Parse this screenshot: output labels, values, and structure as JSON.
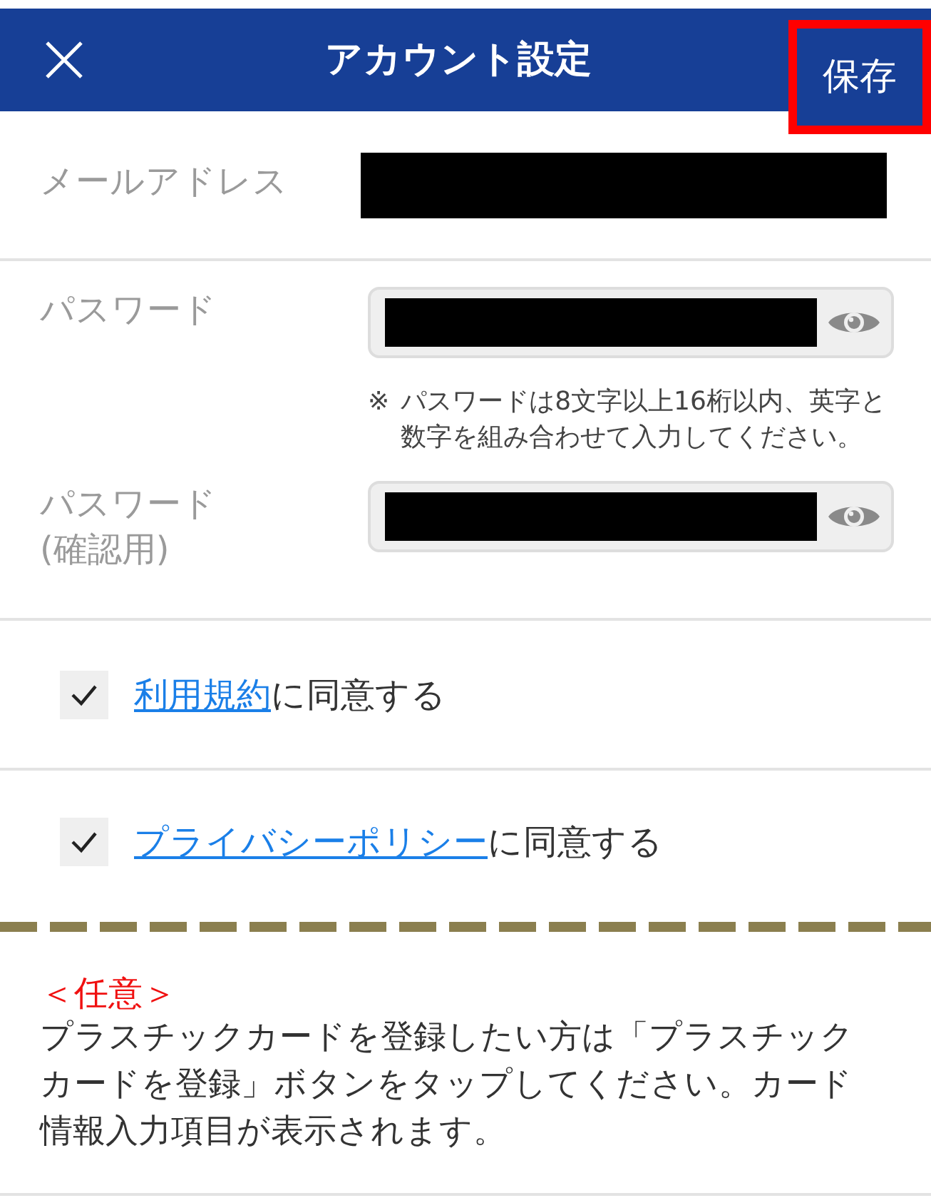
{
  "header": {
    "title": "アカウント設定",
    "save": {
      "label": "保存",
      "highlighted": true
    }
  },
  "fields": [
    {
      "kind": "text",
      "label": "メールアドレス",
      "redacted": true
    },
    {
      "kind": "password",
      "label": "パスワード",
      "redacted": true,
      "note_mark": "※",
      "note": "パスワードは8文字以上16桁以内、英字と数字を組み合わせて入力してください。"
    },
    {
      "kind": "password",
      "label": "パスワード\n(確認用)",
      "redacted": true
    }
  ],
  "agreements": [
    {
      "link": "利用規約",
      "text": "に同意する",
      "checked": true
    },
    {
      "link": "プライバシーポリシー",
      "text": "に同意する",
      "checked": true
    }
  ],
  "optional": {
    "tag": "＜任意＞",
    "text": "プラスチックカードを登録したい方は「プラスチックカードを登録」ボタンをタップしてください。カード情報入力項目が表示されます。"
  }
}
